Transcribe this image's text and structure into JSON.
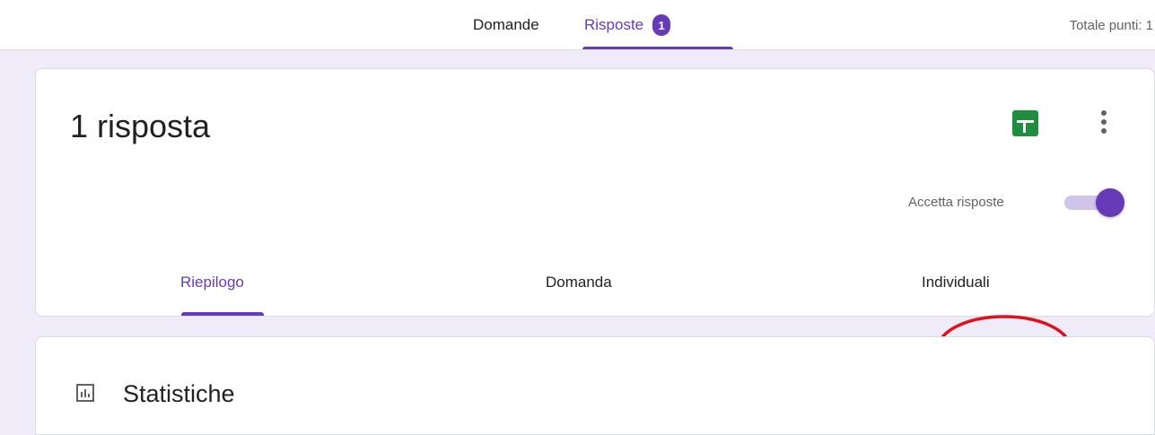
{
  "topbar": {
    "tabs": [
      {
        "label": "Domande",
        "active": false
      },
      {
        "label": "Risposte",
        "active": true,
        "badge": "1"
      }
    ],
    "total_points": "Totale punti: 1"
  },
  "summary": {
    "title": "1 risposta",
    "accept_label": "Accetta risposte",
    "accept_on": true,
    "tabs": [
      {
        "label": "Riepilogo",
        "active": true
      },
      {
        "label": "Domanda",
        "active": false
      },
      {
        "label": "Individuali",
        "active": false,
        "annotated": true
      }
    ]
  },
  "stats": {
    "title": "Statistiche",
    "icon": "bar-chart-icon"
  },
  "colors": {
    "accent": "#673ab7",
    "background": "#f0ebf8",
    "sheets_green": "#1e8e3e",
    "annotation_red": "#e0111b"
  }
}
